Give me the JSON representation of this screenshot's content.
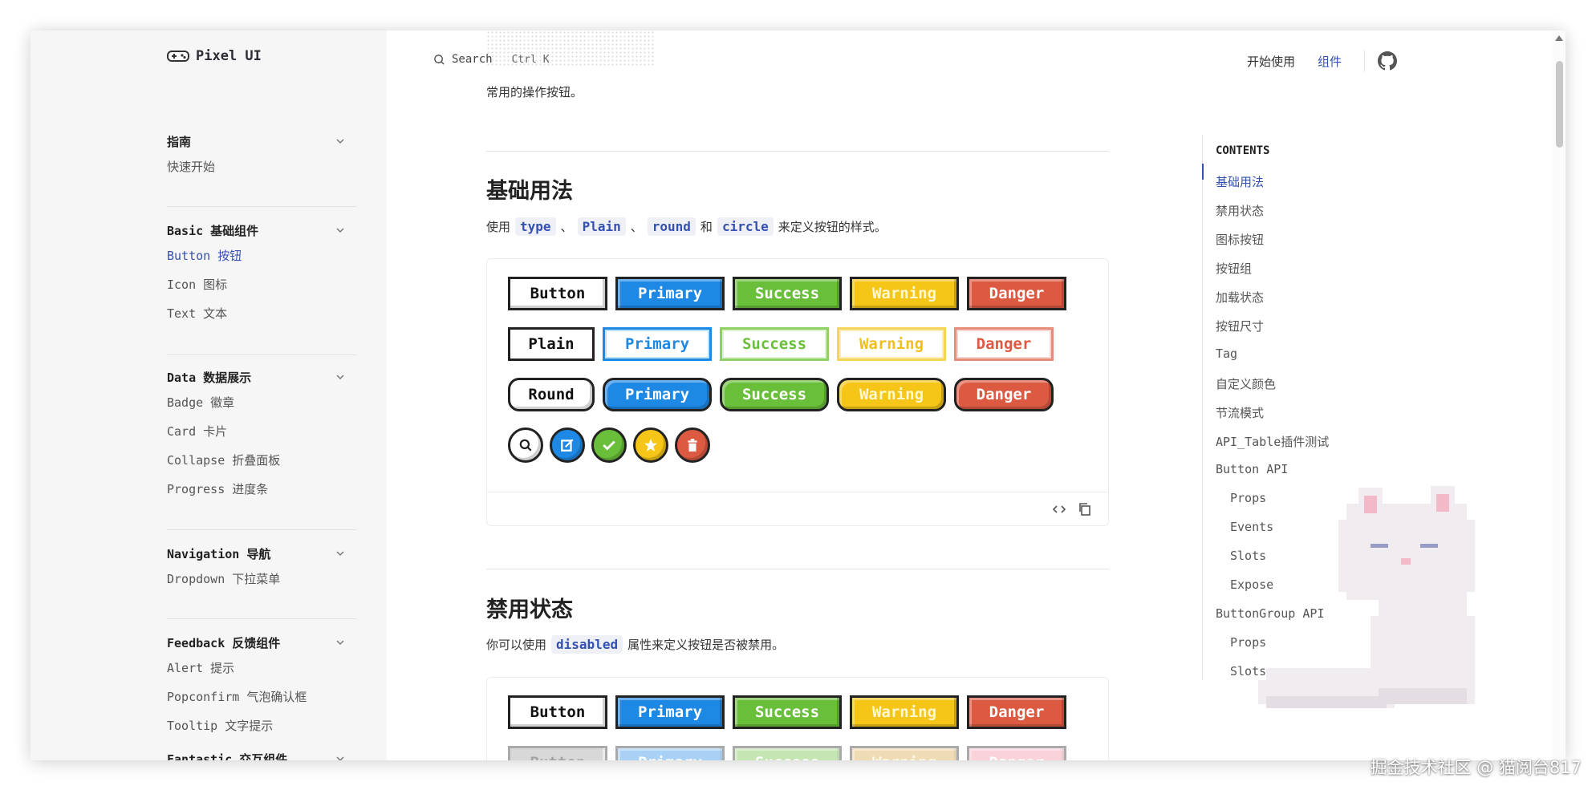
{
  "brand": {
    "name": "Pixel UI",
    "icon": "gamepad-icon"
  },
  "search": {
    "label": "Search",
    "shortcut": "Ctrl K"
  },
  "top_nav": {
    "items": [
      {
        "label": "开始使用"
      },
      {
        "label": "组件",
        "active": true
      }
    ],
    "github_icon": "github-icon"
  },
  "sidebar": {
    "groups": [
      {
        "title": "指南",
        "items": [
          {
            "label": "快速开始"
          }
        ]
      },
      {
        "title": "Basic 基础组件",
        "items": [
          {
            "label": "Button 按钮",
            "active": true
          },
          {
            "label": "Icon 图标"
          },
          {
            "label": "Text 文本"
          }
        ]
      },
      {
        "title": "Data 数据展示",
        "items": [
          {
            "label": "Badge 徽章"
          },
          {
            "label": "Card 卡片"
          },
          {
            "label": "Collapse 折叠面板"
          },
          {
            "label": "Progress 进度条"
          }
        ]
      },
      {
        "title": "Navigation 导航",
        "items": [
          {
            "label": "Dropdown 下拉菜单"
          }
        ]
      },
      {
        "title": "Feedback 反馈组件",
        "items": [
          {
            "label": "Alert 提示"
          },
          {
            "label": "Popconfirm 气泡确认框"
          },
          {
            "label": "Tooltip 文字提示"
          }
        ]
      },
      {
        "title": "Fantastic 交互组件",
        "items": []
      }
    ]
  },
  "main": {
    "intro": "常用的操作按钮。",
    "sections": [
      {
        "title": "基础用法",
        "desc_prefix": "使用",
        "codes": [
          "type",
          "Plain",
          "round",
          "circle"
        ],
        "sep1": "、",
        "sep2": "、",
        "sep3": "和",
        "desc_suffix": "来定义按钮的样式。"
      },
      {
        "title": "禁用状态",
        "desc_prefix": "你可以使用",
        "code": "disabled",
        "desc_suffix": "属性来定义按钮是否被禁用。"
      }
    ],
    "button_rows": {
      "solid": [
        "Button",
        "Primary",
        "Success",
        "Warning",
        "Danger"
      ],
      "plain": [
        "Plain",
        "Primary",
        "Success",
        "Warning",
        "Danger"
      ],
      "round": [
        "Round",
        "Primary",
        "Success",
        "Warning",
        "Danger"
      ],
      "disabled": [
        "Button",
        "Primary",
        "Success",
        "Warning",
        "Danger"
      ],
      "disabled_plain": [
        "Button",
        "Primary",
        "Success",
        "Warning",
        "Danger"
      ]
    },
    "circle_icons": [
      "search-icon",
      "edit-icon",
      "check-icon",
      "star-icon",
      "delete-icon"
    ]
  },
  "toc": {
    "title": "CONTENTS",
    "items": [
      {
        "label": "基础用法",
        "active": true
      },
      {
        "label": "禁用状态"
      },
      {
        "label": "图标按钮"
      },
      {
        "label": "按钮组"
      },
      {
        "label": "加载状态"
      },
      {
        "label": "按钮尺寸"
      },
      {
        "label": "Tag"
      },
      {
        "label": "自定义颜色"
      },
      {
        "label": "节流模式"
      },
      {
        "label": "API_Table插件测试"
      },
      {
        "label": "Button API"
      },
      {
        "label": "Props",
        "sub": true
      },
      {
        "label": "Events",
        "sub": true
      },
      {
        "label": "Slots",
        "sub": true
      },
      {
        "label": "Expose",
        "sub": true
      },
      {
        "label": "ButtonGroup API"
      },
      {
        "label": "Props",
        "sub": true
      },
      {
        "label": "Slots",
        "sub": true
      }
    ]
  },
  "watermark": "掘金技术社区 @ 猫阅台817",
  "colors": {
    "accent": "#3451b2",
    "primary": "#1e88e5",
    "success": "#6abf3a",
    "warning": "#f5c518",
    "danger": "#dc5a42"
  }
}
